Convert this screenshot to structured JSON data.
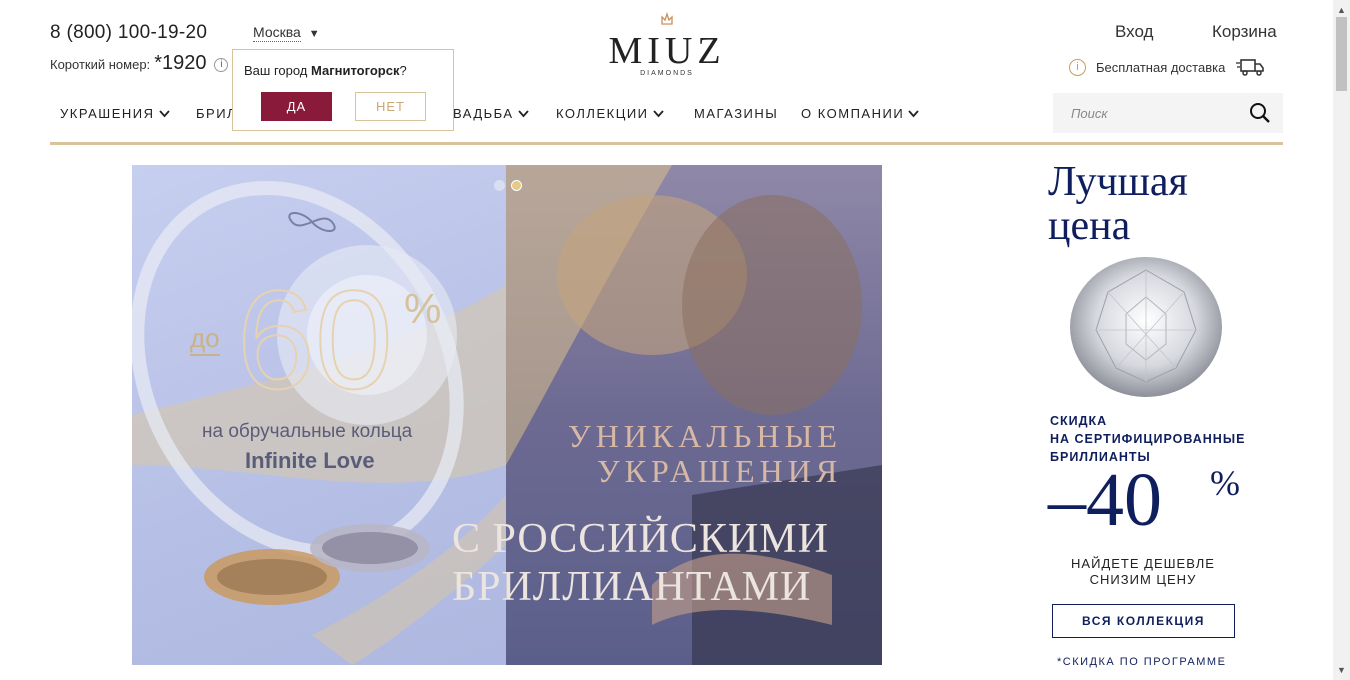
{
  "header": {
    "phone": "8 (800) 100-19-20",
    "short_label": "Короткий номер:",
    "short_number": "*1920",
    "info_glyph": "i",
    "city": "Москва",
    "city_arrow": "▼",
    "login": "Вход",
    "cart": "Корзина",
    "delivery": "Бесплатная доставка",
    "delivery_icon": "truck-icon"
  },
  "logo": {
    "brand": "MIUZ",
    "sub": "DIAMONDS",
    "crown_icon": "crown-icon"
  },
  "city_popup": {
    "question_prefix": "Ваш город ",
    "question_city": "Магнитогорск",
    "question_suffix": "?",
    "yes": "ДА",
    "no": "НЕТ"
  },
  "nav": {
    "items": [
      {
        "label": "УКРАШЕНИЯ",
        "has_dropdown": true
      },
      {
        "label": "БРИЛ",
        "has_dropdown": false
      },
      {
        "label": "ВАДЬБА",
        "has_dropdown": true
      },
      {
        "label": "КОЛЛЕКЦИИ",
        "has_dropdown": true
      },
      {
        "label": "МАГАЗИНЫ",
        "has_dropdown": false
      },
      {
        "label": "О КОМПАНИИ",
        "has_dropdown": true
      }
    ]
  },
  "search": {
    "placeholder": "Поиск",
    "icon": "search-icon"
  },
  "banner": {
    "slides_count": 2,
    "active_slide": 2,
    "promo_prefix": "до",
    "promo_value": "60",
    "promo_sign": "%",
    "promo_line1": "на обручальные кольца",
    "promo_line2": "Infinite Love",
    "headline1": "УНИКАЛЬНЫЕ",
    "headline2": "УКРАШЕНИЯ",
    "headline3": "С РОССИЙСКИМИ",
    "headline4": "БРИЛЛИАНТАМИ"
  },
  "side_promo": {
    "title_line1": "Лучшая",
    "title_line2": "цена",
    "sub_line1": "СКИДКА",
    "sub_line2": "НА СЕРТИФИЦИРОВАННЫЕ",
    "sub_line3": "БРИЛЛИАНТЫ",
    "discount": "–40",
    "discount_sign": "%",
    "cheaper_line1": "НАЙДЕТЕ ДЕШЕВЛЕ",
    "cheaper_line2": "СНИЗИМ ЦЕНУ",
    "button": "ВСЯ КОЛЛЕКЦИЯ",
    "footnote": "*СКИДКА ПО ПРОГРАММЕ"
  },
  "colors": {
    "gold": "#d8c39a",
    "wine": "#8a1a3a",
    "navy": "#0f1f5e"
  }
}
